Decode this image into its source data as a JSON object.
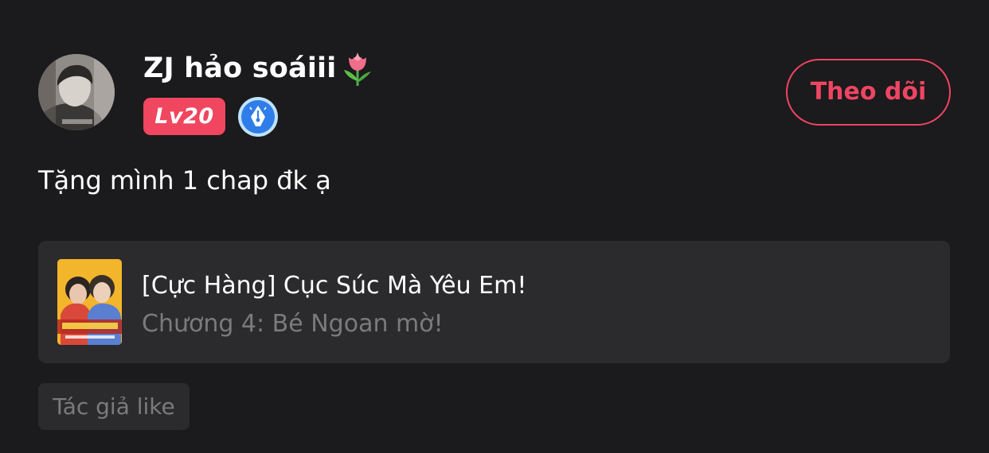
{
  "user": {
    "name": "ZJ hảo soáiii",
    "name_emoji_icon": "tulip-icon",
    "level": "Lv20",
    "level_badge_color": "#f0465f",
    "writer_badge_icon": "pen-nib-badge-icon",
    "avatar_icon": "user-avatar"
  },
  "actions": {
    "follow_label": "Theo dõi",
    "accent_color": "#ef4562"
  },
  "comment": {
    "text": "Tặng mình 1 chap đk ạ"
  },
  "chapter_card": {
    "comic_title": "[Cực Hàng] Cục Súc Mà Yêu Em!",
    "chapter_name": "Chương 4: Bé Ngoan mờ!",
    "cover_icon": "comic-cover-thumbnail"
  },
  "tags": {
    "author_like": "Tác giả like"
  }
}
